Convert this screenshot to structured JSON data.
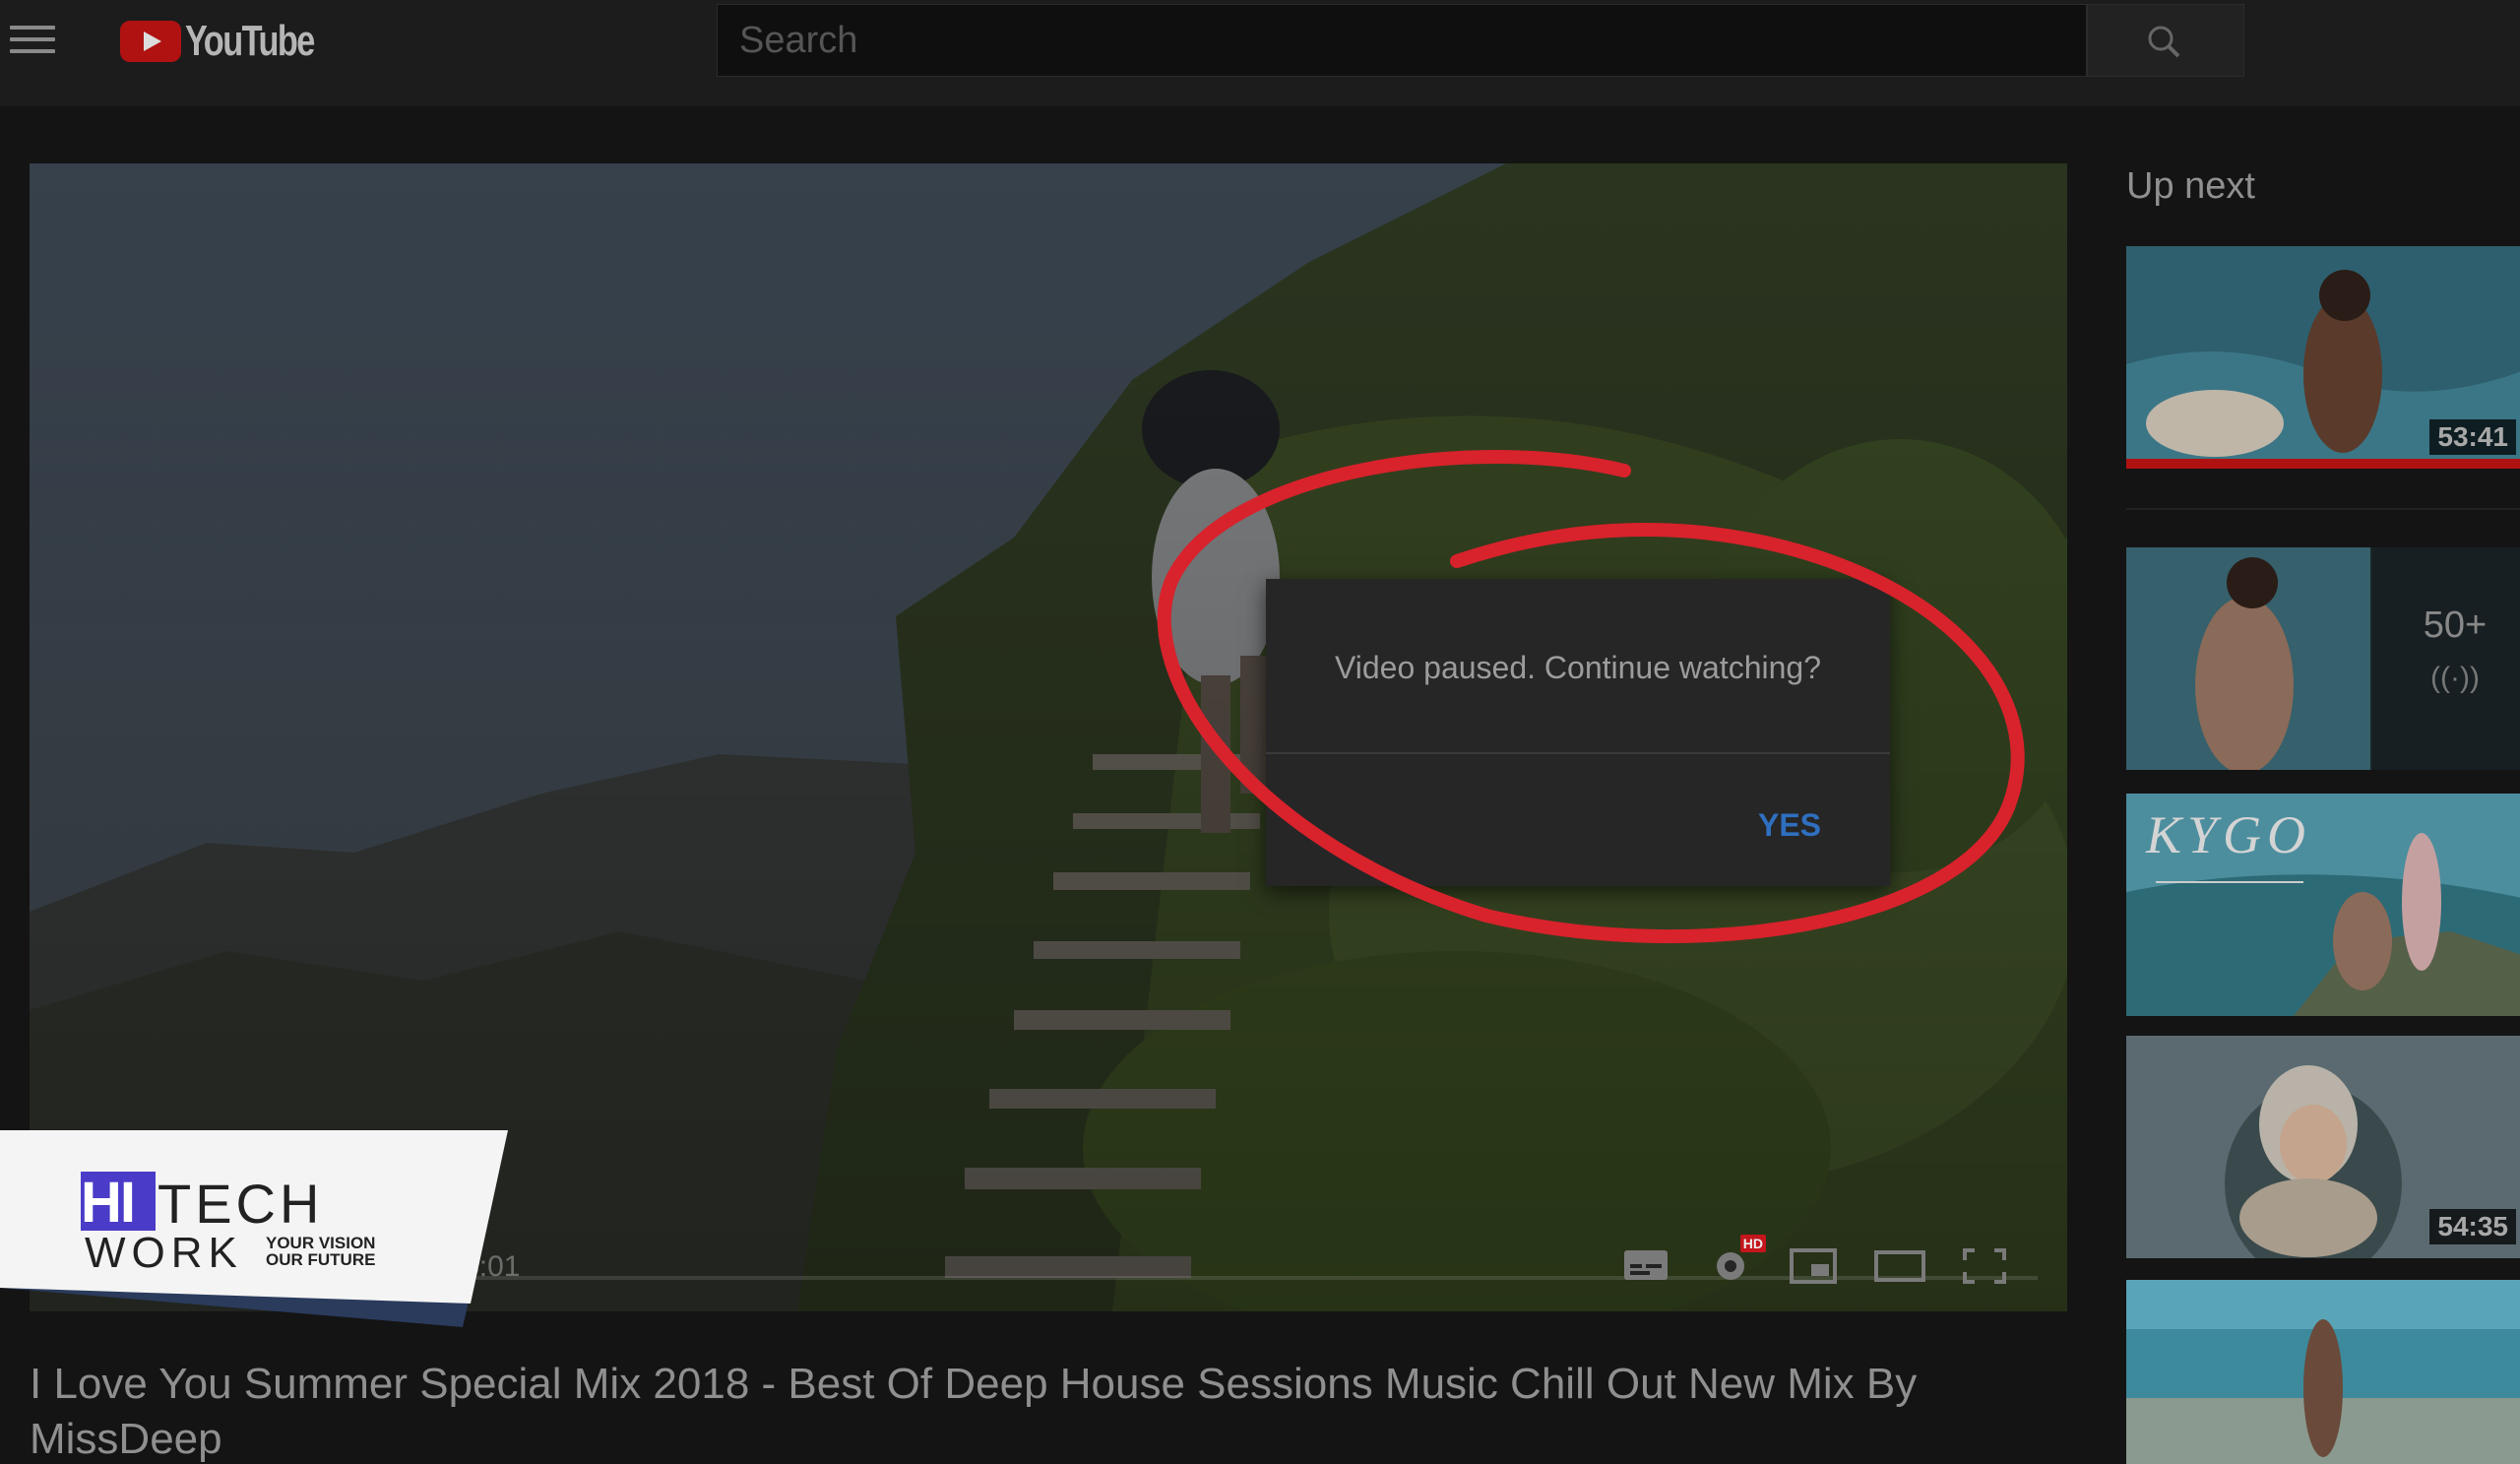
{
  "header": {
    "logo_text": "YouTube",
    "search_placeholder": "Search"
  },
  "player": {
    "time_display": "3:10 / 54:01",
    "dialog": {
      "message": "Video paused. Continue watching?",
      "yes_label": "YES"
    },
    "hd_badge": "HD"
  },
  "watermark": {
    "hi": "HI",
    "tech": "TECH",
    "work": "WORK",
    "tagline_1": "YOUR VISION",
    "tagline_2": "OUR FUTURE"
  },
  "video": {
    "title": "I Love You Summer Special Mix 2018 - Best Of Deep House Sessions Music Chill Out New Mix By MissDeep"
  },
  "sidebar": {
    "heading": "Up next",
    "cards": [
      {
        "duration": "53:41"
      },
      {
        "mix_count": "50+",
        "mix_icon": "((·))"
      },
      {
        "overlay_text": "KYGO"
      },
      {
        "duration": "54:35"
      },
      {}
    ]
  },
  "colors": {
    "accent_red": "#d8222c",
    "yes_blue": "#2f6fbf",
    "brand_purple": "#4a3cc8"
  }
}
